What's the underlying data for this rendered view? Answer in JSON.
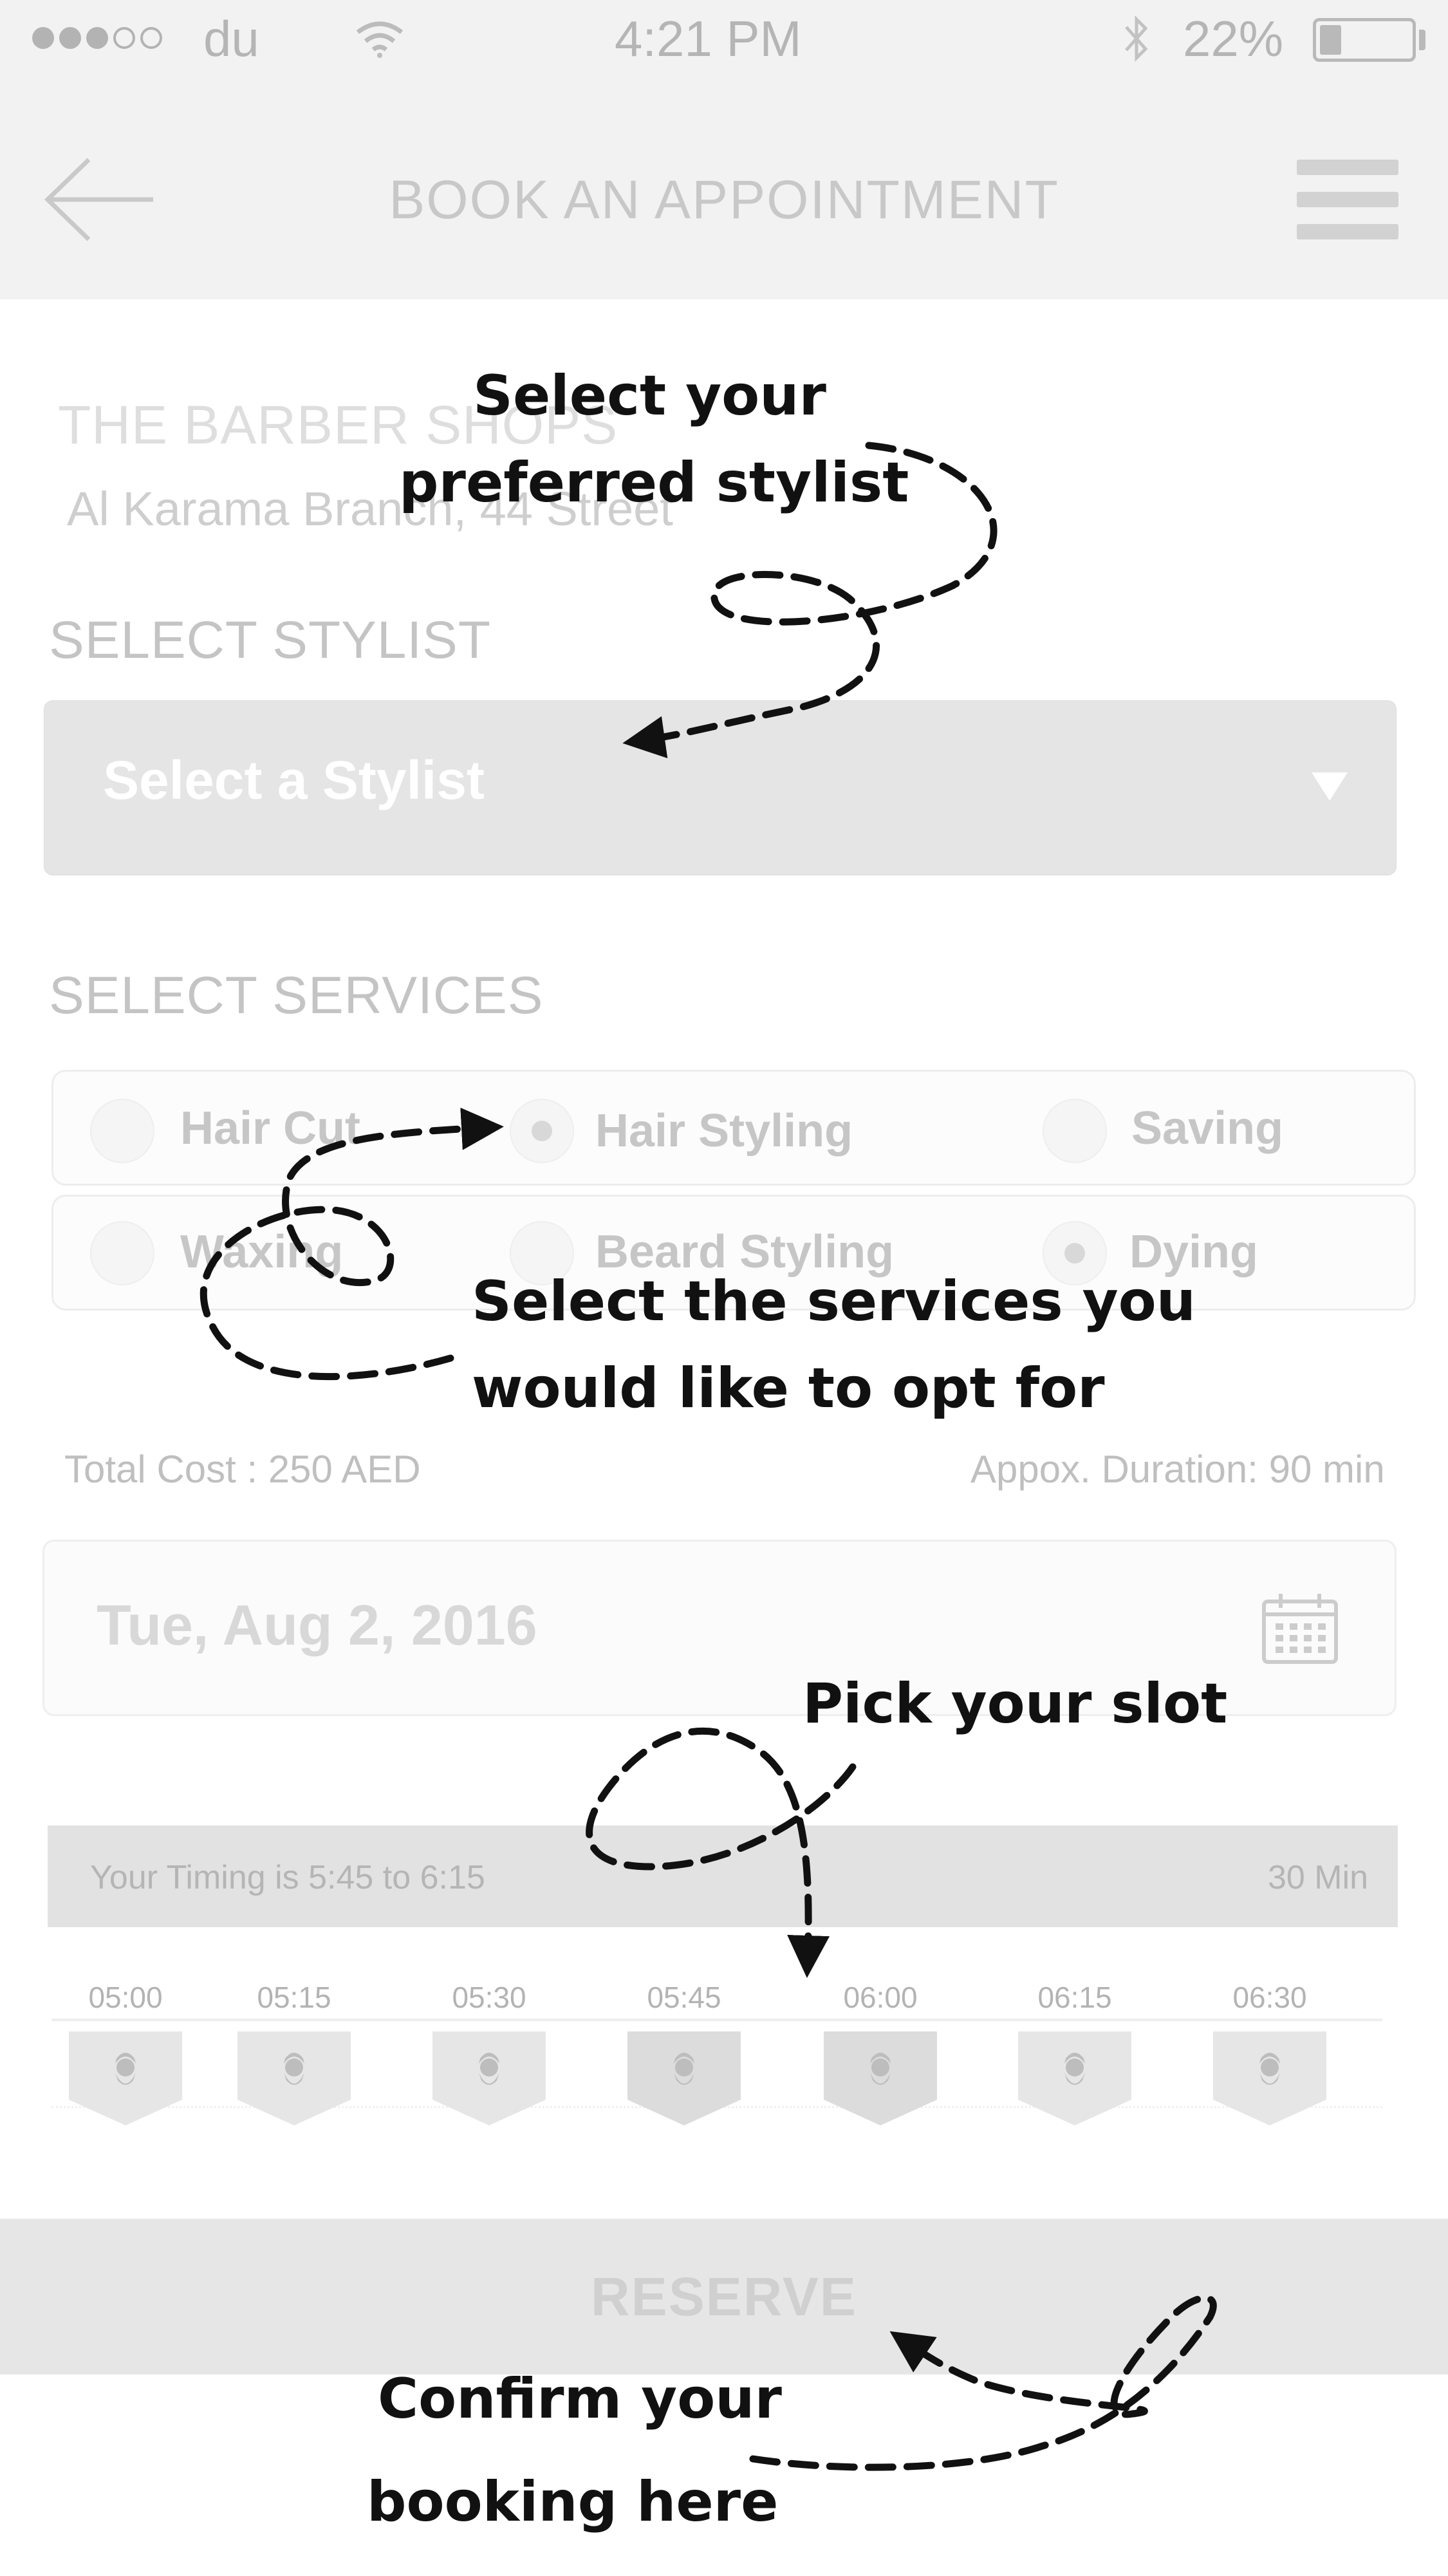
{
  "status_bar": {
    "carrier": "du",
    "time": "4:21 PM",
    "battery_percent": "22%",
    "battery_level": 0.22,
    "signal_bars_filled": 3,
    "signal_bars_total": 5,
    "icons": [
      "wifi-icon",
      "bluetooth-icon",
      "battery-icon"
    ]
  },
  "nav": {
    "title": "BOOK AN APPOINTMENT",
    "back_icon": "back-arrow-icon",
    "menu_icon": "hamburger-menu-icon"
  },
  "shop": {
    "name": "THE BARBER SHOPS",
    "branch": "Al Karama Branch, 44 Street"
  },
  "stylist": {
    "section_label": "SELECT STYLIST",
    "placeholder": "Select a Stylist",
    "icon": "caret-down-icon"
  },
  "services": {
    "section_label": "SELECT SERVICES",
    "items": [
      {
        "label": "Hair Cut",
        "selected": false
      },
      {
        "label": "Hair Styling",
        "selected": true
      },
      {
        "label": "Saving",
        "selected": false
      },
      {
        "label": "Waxing",
        "selected": false
      },
      {
        "label": "Beard Styling",
        "selected": false
      },
      {
        "label": "Dying",
        "selected": true
      }
    ]
  },
  "summary": {
    "total_cost": "Total Cost : 250 AED",
    "duration": "Appox. Duration: 90 min"
  },
  "date": {
    "value": "Tue, Aug 2, 2016",
    "icon": "calendar-icon"
  },
  "timing": {
    "text": "Your Timing is 5:45 to 6:15",
    "duration": "30 Min"
  },
  "slots": [
    {
      "time": "05:00",
      "selected": false
    },
    {
      "time": "05:15",
      "selected": false
    },
    {
      "time": "05:30",
      "selected": false
    },
    {
      "time": "05:45",
      "selected": true
    },
    {
      "time": "06:00",
      "selected": true
    },
    {
      "time": "06:15",
      "selected": false
    },
    {
      "time": "06:30",
      "selected": false
    }
  ],
  "reserve_label": "RESERVE",
  "callouts": {
    "stylist_line1": "Select your",
    "stylist_line2": "preferred stylist",
    "services_line1": "Select the services you",
    "services_line2": "would like to opt for",
    "slot": "Pick your slot",
    "confirm_line1": "Confirm your",
    "confirm_line2": "booking here"
  },
  "colors": {
    "background": "#ffffff",
    "header_gray": "#f2f2f2",
    "muted_text": "#c4c4c4",
    "callout_text": "#111111",
    "selected_slot": "#dcdcdc",
    "unselected_slot": "#e6e6e6"
  }
}
